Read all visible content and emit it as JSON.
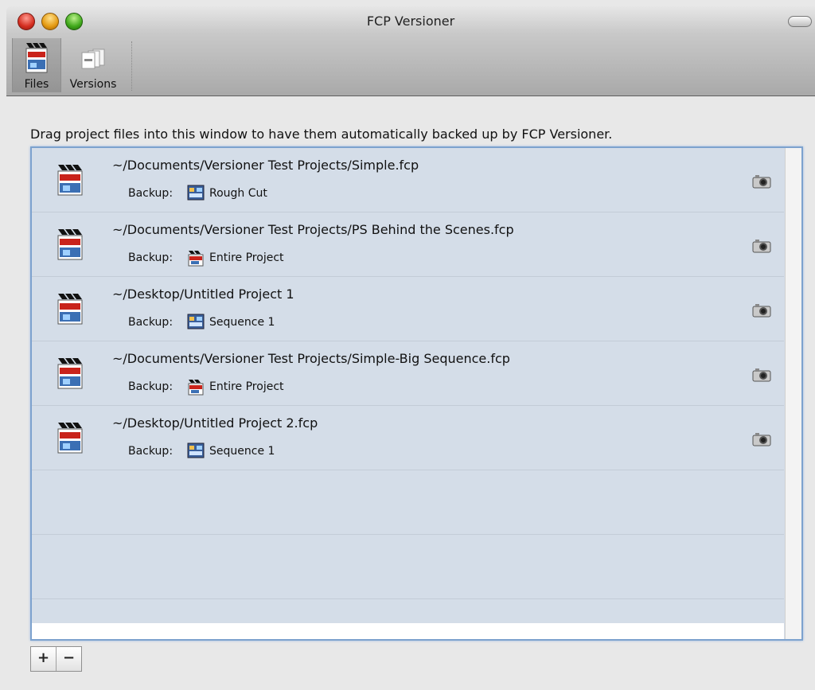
{
  "window": {
    "title": "FCP Versioner"
  },
  "toolbar": {
    "files_label": "Files",
    "versions_label": "Versions"
  },
  "instructions": "Drag project files into this window to have them automatically backed up by FCP Versioner.",
  "backup_label": "Backup:",
  "projects": [
    {
      "path": "~/Documents/Versioner Test Projects/Simple.fcp",
      "backup": "Rough Cut",
      "backup_icon": "sequence-icon"
    },
    {
      "path": "~/Documents/Versioner Test Projects/PS Behind the Scenes.fcp",
      "backup": "Entire Project",
      "backup_icon": "project-icon"
    },
    {
      "path": "~/Desktop/Untitled Project 1",
      "backup": "Sequence 1",
      "backup_icon": "sequence-icon"
    },
    {
      "path": "~/Documents/Versioner Test Projects/Simple-Big Sequence.fcp",
      "backup": "Entire Project",
      "backup_icon": "project-icon"
    },
    {
      "path": "~/Desktop/Untitled Project 2.fcp",
      "backup": "Sequence 1",
      "backup_icon": "sequence-icon"
    }
  ],
  "buttons": {
    "add": "+",
    "remove": "−"
  }
}
